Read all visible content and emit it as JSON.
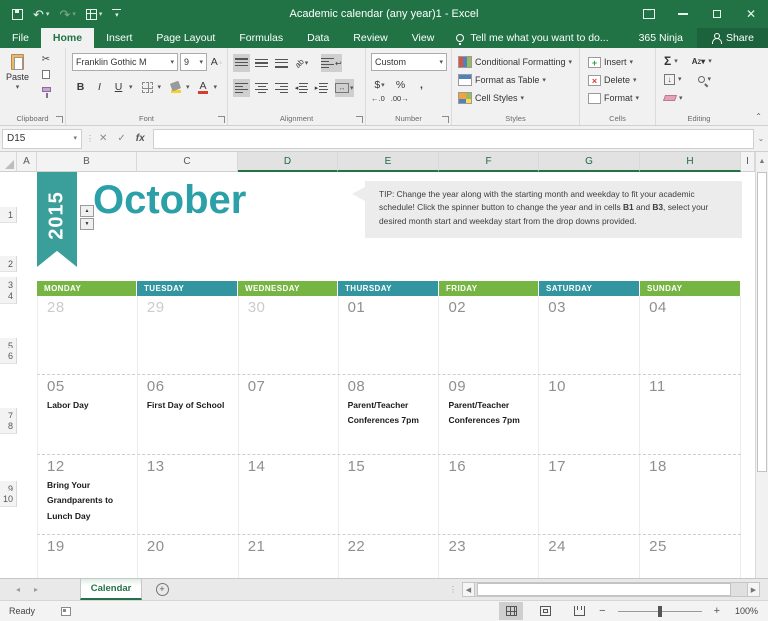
{
  "titlebar": {
    "title": "Academic calendar (any year)1 - Excel"
  },
  "menubar": {
    "tabs": [
      "File",
      "Home",
      "Insert",
      "Page Layout",
      "Formulas",
      "Data",
      "Review",
      "View"
    ],
    "active_tab": "Home",
    "tell_me": "Tell me what you want to do...",
    "account": "365 Ninja",
    "share": "Share"
  },
  "ribbon": {
    "clipboard": {
      "label": "Clipboard",
      "paste": "Paste"
    },
    "font": {
      "label": "Font",
      "name": "Franklin Gothic M",
      "size": "9",
      "bold": "B",
      "italic": "I",
      "underline": "U",
      "grow": "A",
      "shrink": "A",
      "color": "A"
    },
    "alignment": {
      "label": "Alignment"
    },
    "number": {
      "label": "Number",
      "format": "Custom",
      "currency": "$",
      "percent": "%",
      "comma": ",",
      "inc_dec": ".00",
      "dec_dec": ".00"
    },
    "styles": {
      "label": "Styles",
      "conditional": "Conditional Formatting",
      "format_table": "Format as Table",
      "cell_styles": "Cell Styles"
    },
    "cells": {
      "label": "Cells",
      "insert": "Insert",
      "delete": "Delete",
      "format": "Format"
    },
    "editing": {
      "label": "Editing",
      "autosum": "Σ",
      "sort": "AZ"
    }
  },
  "formula_bar": {
    "name_box": "D15",
    "fx": "fx"
  },
  "grid": {
    "columns": [
      "A",
      "B",
      "C",
      "D",
      "E",
      "F",
      "G",
      "H",
      "I"
    ],
    "selected_columns": [
      "D",
      "E",
      "F",
      "G",
      "H"
    ],
    "rows": [
      "1",
      "2",
      "3",
      "4",
      "5",
      "6",
      "7",
      "8",
      "9",
      "10"
    ]
  },
  "calendar": {
    "year": "2015",
    "month": "October",
    "tip": {
      "t1": "TIP: Change the year along with the starting month and weekday to fit your academic schedule! Click the spinner button to change the year and in cells ",
      "b1": "B1",
      "t2": " and ",
      "b2": "B3",
      "t3": ", select your desired month start and weekday start from the drop downs provided."
    },
    "day_headers": [
      {
        "label": "MONDAY",
        "color": "green"
      },
      {
        "label": "TUESDAY",
        "color": "teal"
      },
      {
        "label": "WEDNESDAY",
        "color": "green"
      },
      {
        "label": "THURSDAY",
        "color": "teal"
      },
      {
        "label": "FRIDAY",
        "color": "green"
      },
      {
        "label": "SATURDAY",
        "color": "teal"
      },
      {
        "label": "SUNDAY",
        "color": "green"
      }
    ],
    "weeks": [
      [
        {
          "date": "28",
          "muted": true
        },
        {
          "date": "29",
          "muted": true
        },
        {
          "date": "30",
          "muted": true
        },
        {
          "date": "01"
        },
        {
          "date": "02"
        },
        {
          "date": "03"
        },
        {
          "date": "04"
        }
      ],
      [
        {
          "date": "05",
          "event": "Labor Day"
        },
        {
          "date": "06",
          "event": "First Day of School"
        },
        {
          "date": "07"
        },
        {
          "date": "08",
          "event": "Parent/Teacher Conferences 7pm"
        },
        {
          "date": "09",
          "event": "Parent/Teacher Conferences 7pm"
        },
        {
          "date": "10"
        },
        {
          "date": "11"
        }
      ],
      [
        {
          "date": "12",
          "event": "Bring Your Grandparents to Lunch Day"
        },
        {
          "date": "13"
        },
        {
          "date": "14"
        },
        {
          "date": "15"
        },
        {
          "date": "16"
        },
        {
          "date": "17"
        },
        {
          "date": "18"
        }
      ],
      [
        {
          "date": "19"
        },
        {
          "date": "20"
        },
        {
          "date": "21"
        },
        {
          "date": "22"
        },
        {
          "date": "23"
        },
        {
          "date": "24"
        },
        {
          "date": "25"
        }
      ]
    ]
  },
  "sheet_tabs": {
    "active": "Calendar"
  },
  "status_bar": {
    "status": "Ready",
    "zoom": "100%"
  },
  "colors": {
    "excel_green": "#217346",
    "banner_teal": "#3a9e9b",
    "month_teal": "#2ba0a8",
    "header_green": "#76b543",
    "header_teal": "#3295a0"
  }
}
